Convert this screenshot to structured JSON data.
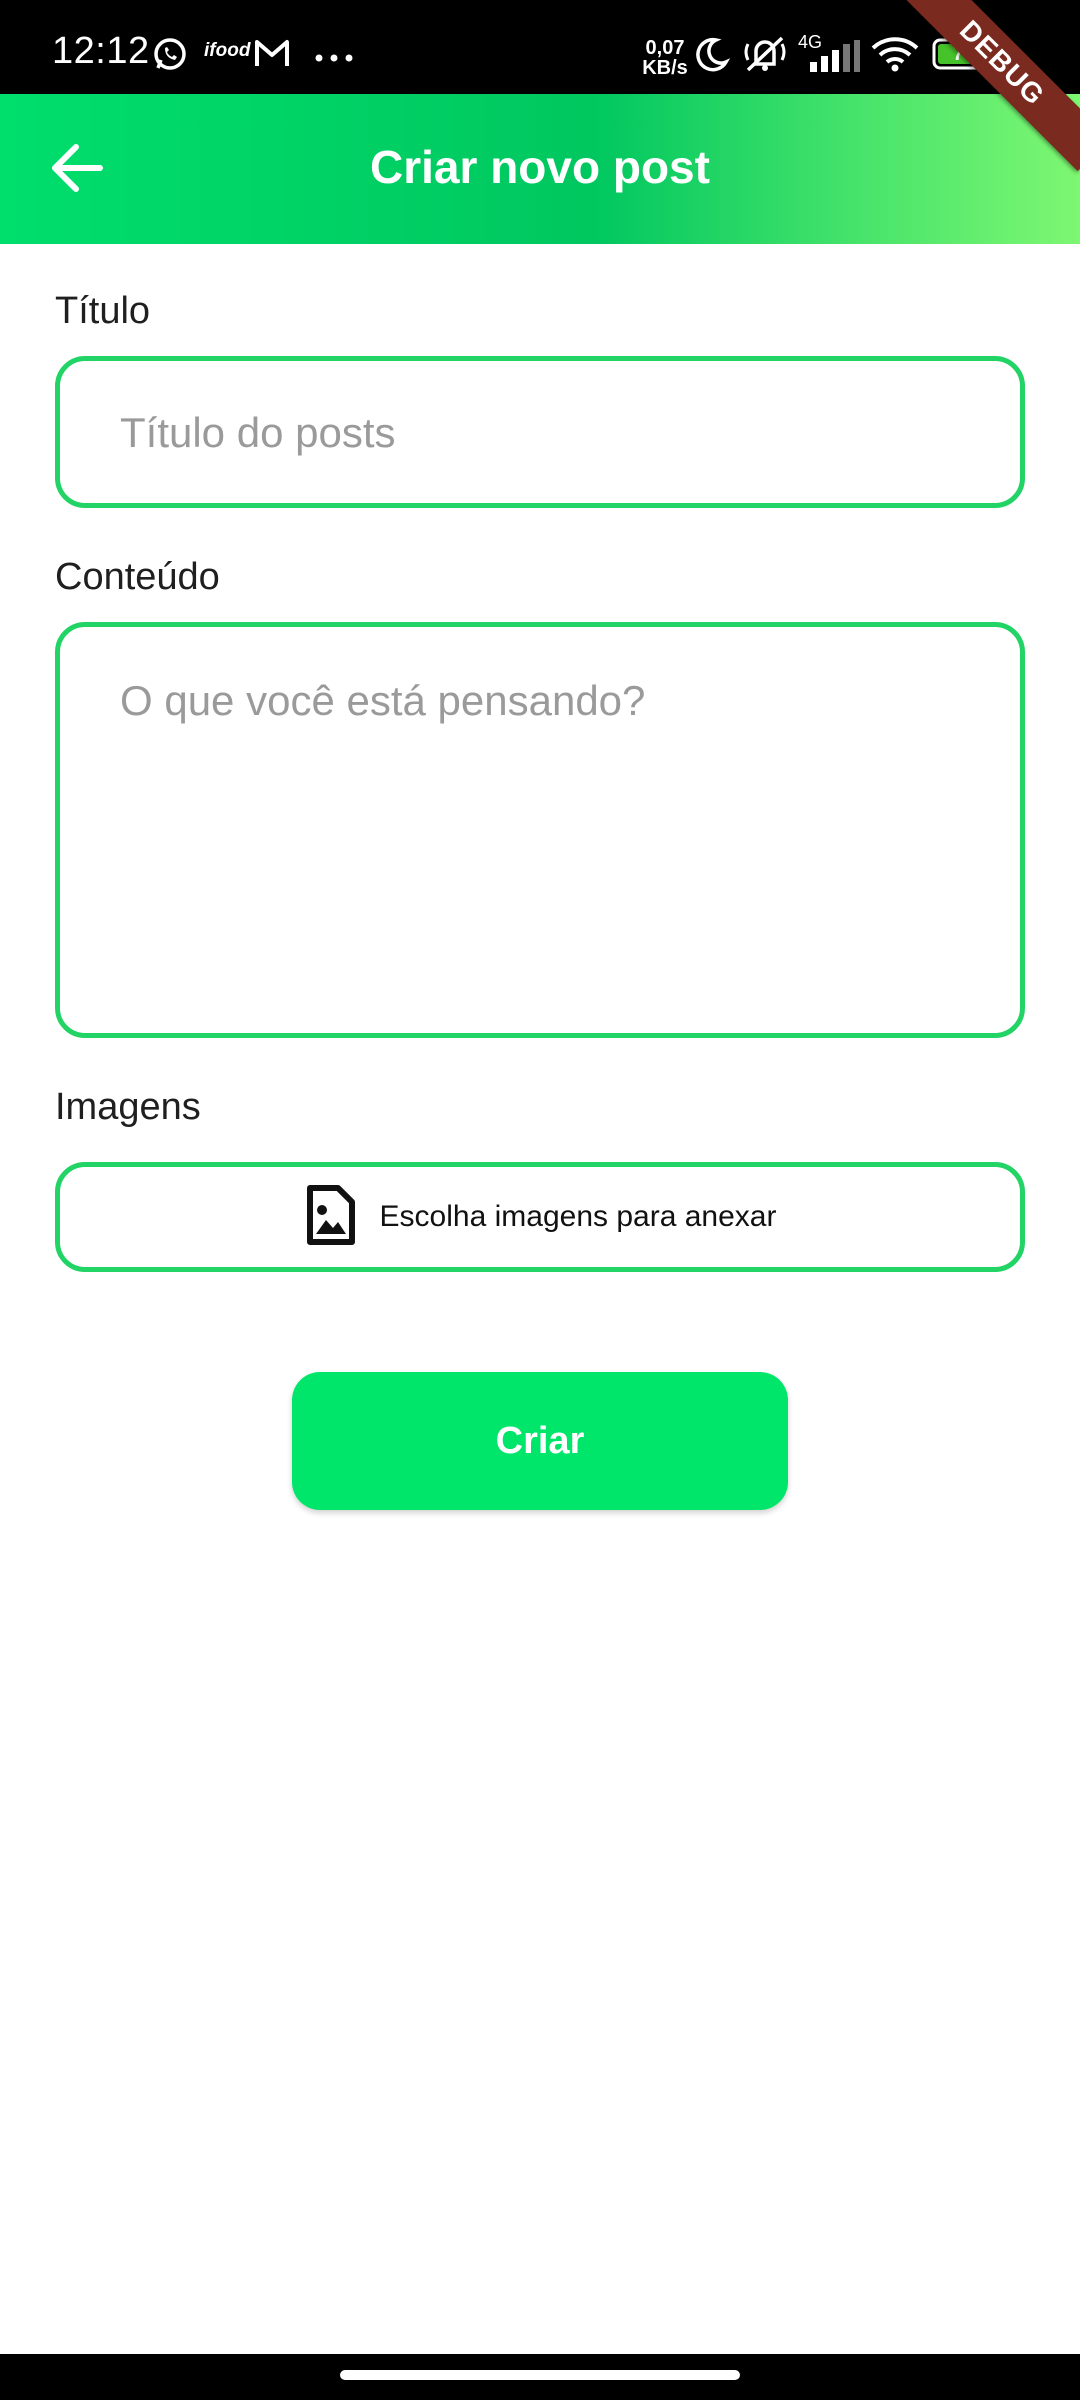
{
  "status_bar": {
    "time": "12:12",
    "network_speed_value": "0,07",
    "network_speed_unit": "KB/s",
    "network_type": "4G",
    "battery_level": "74",
    "icons": [
      "whatsapp-icon",
      "ifood-icon",
      "gmail-icon",
      "more-dots-icon",
      "moon-icon",
      "mute-icon",
      "signal-icon",
      "wifi-icon",
      "battery-icon"
    ],
    "ifood_label": "ifood",
    "debug_ribbon": "DEBUG"
  },
  "app_bar": {
    "title": "Criar novo post",
    "back_icon": "arrow-back-icon"
  },
  "form": {
    "title_label": "Título",
    "title_placeholder": "Título do posts",
    "content_label": "Conteúdo",
    "content_placeholder": "O que você está pensando?",
    "images_label": "Imagens",
    "attach_label": "Escolha imagens para anexar",
    "attach_icon": "image-file-icon",
    "create_label": "Criar"
  },
  "colors": {
    "accent": "#00e66b",
    "border": "#22d365",
    "placeholder": "#9a9a9a"
  }
}
